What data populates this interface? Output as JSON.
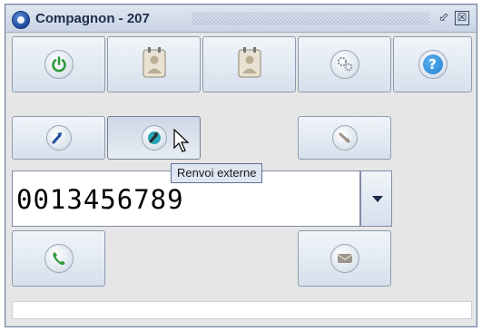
{
  "window": {
    "title": "Compagnon - 207",
    "restore_glyph": "⬃",
    "close_glyph": "☒"
  },
  "toolbar_row1": [
    {
      "name": "power",
      "icon": "power-icon",
      "color": "#2c9a3a"
    },
    {
      "name": "contact-card-1",
      "icon": "contact-card-icon"
    },
    {
      "name": "contact-card-2",
      "icon": "contact-card-icon"
    },
    {
      "name": "settings",
      "icon": "gears-icon"
    },
    {
      "name": "help",
      "icon": "help-icon",
      "glyph": "?",
      "color": "#1f7fd1"
    }
  ],
  "toolbar_row2": [
    {
      "name": "forward-internal",
      "icon": "forward-icon"
    },
    {
      "name": "forward-external",
      "icon": "forward-external-icon",
      "pressed": true
    },
    {
      "name": "transfer",
      "icon": "transfer-icon"
    }
  ],
  "tooltip": {
    "text": "Renvoi externe"
  },
  "number_field": {
    "value": "0013456789"
  },
  "call_row": [
    {
      "name": "call",
      "icon": "phone-icon",
      "color": "#2c9a3a"
    },
    {
      "name": "message",
      "icon": "envelope-icon"
    }
  ],
  "status": {
    "text": ""
  },
  "colors": {
    "accent_green": "#2c9a3a",
    "accent_blue": "#1f7fd1",
    "title_bar": "#c8d3e4"
  }
}
